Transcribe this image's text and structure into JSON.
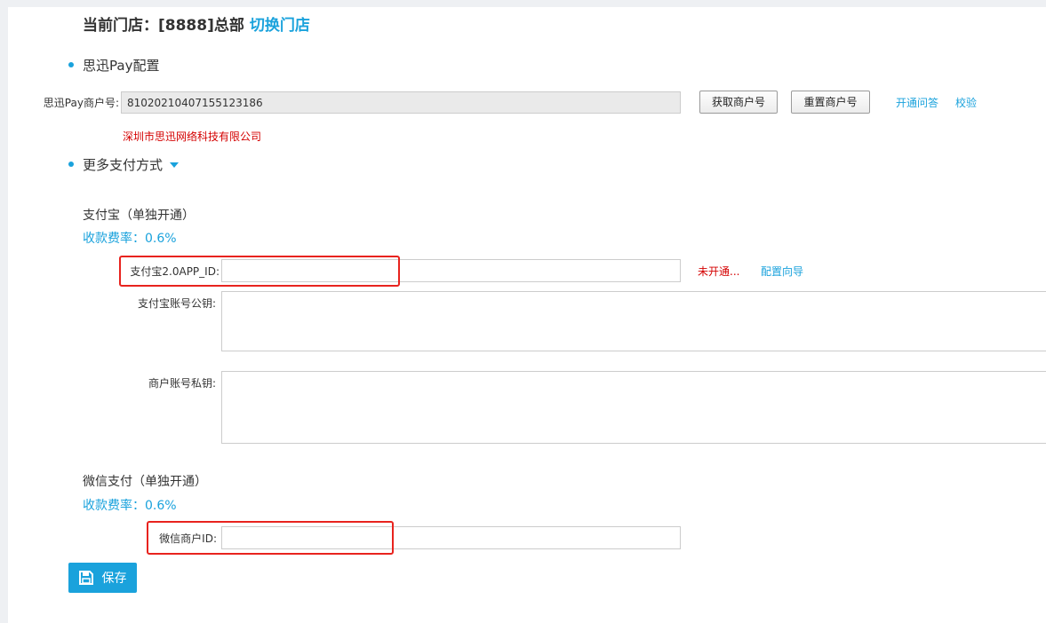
{
  "header": {
    "store_prefix": "当前门店：[8888]总部",
    "switch_store": "切换门店"
  },
  "sixun_pay": {
    "title": "思迅Pay配置",
    "merchant_label": "思迅Pay商户号:",
    "merchant_value": "81020210407155123186",
    "get_merchant_button": "获取商户号",
    "reset_merchant_button": "重置商户号",
    "faq_link": "开通问答",
    "verify_link": "校验",
    "company_name": "深圳市思迅网络科技有限公司"
  },
  "more_payments": {
    "title": "更多支付方式"
  },
  "alipay": {
    "heading": "支付宝（单独开通）",
    "rate": "收款费率：0.6%",
    "app_id_label": "支付宝2.0APP_ID:",
    "app_id_value": "",
    "status": "未开通...",
    "guide_link": "配置向导",
    "public_key_label": "支付宝账号公钥:",
    "public_key_value": "",
    "private_key_label": "商户账号私钥:",
    "private_key_value": ""
  },
  "wechat": {
    "heading": "微信支付（单独开通）",
    "rate": "收款费率：0.6%",
    "merchant_id_label": "微信商户ID:",
    "merchant_id_value": ""
  },
  "save_button": {
    "label": "保存",
    "icon": "save-icon"
  },
  "colors": {
    "accent": "#1aa2dc",
    "error": "#d40000",
    "highlight": "#e8231e"
  }
}
